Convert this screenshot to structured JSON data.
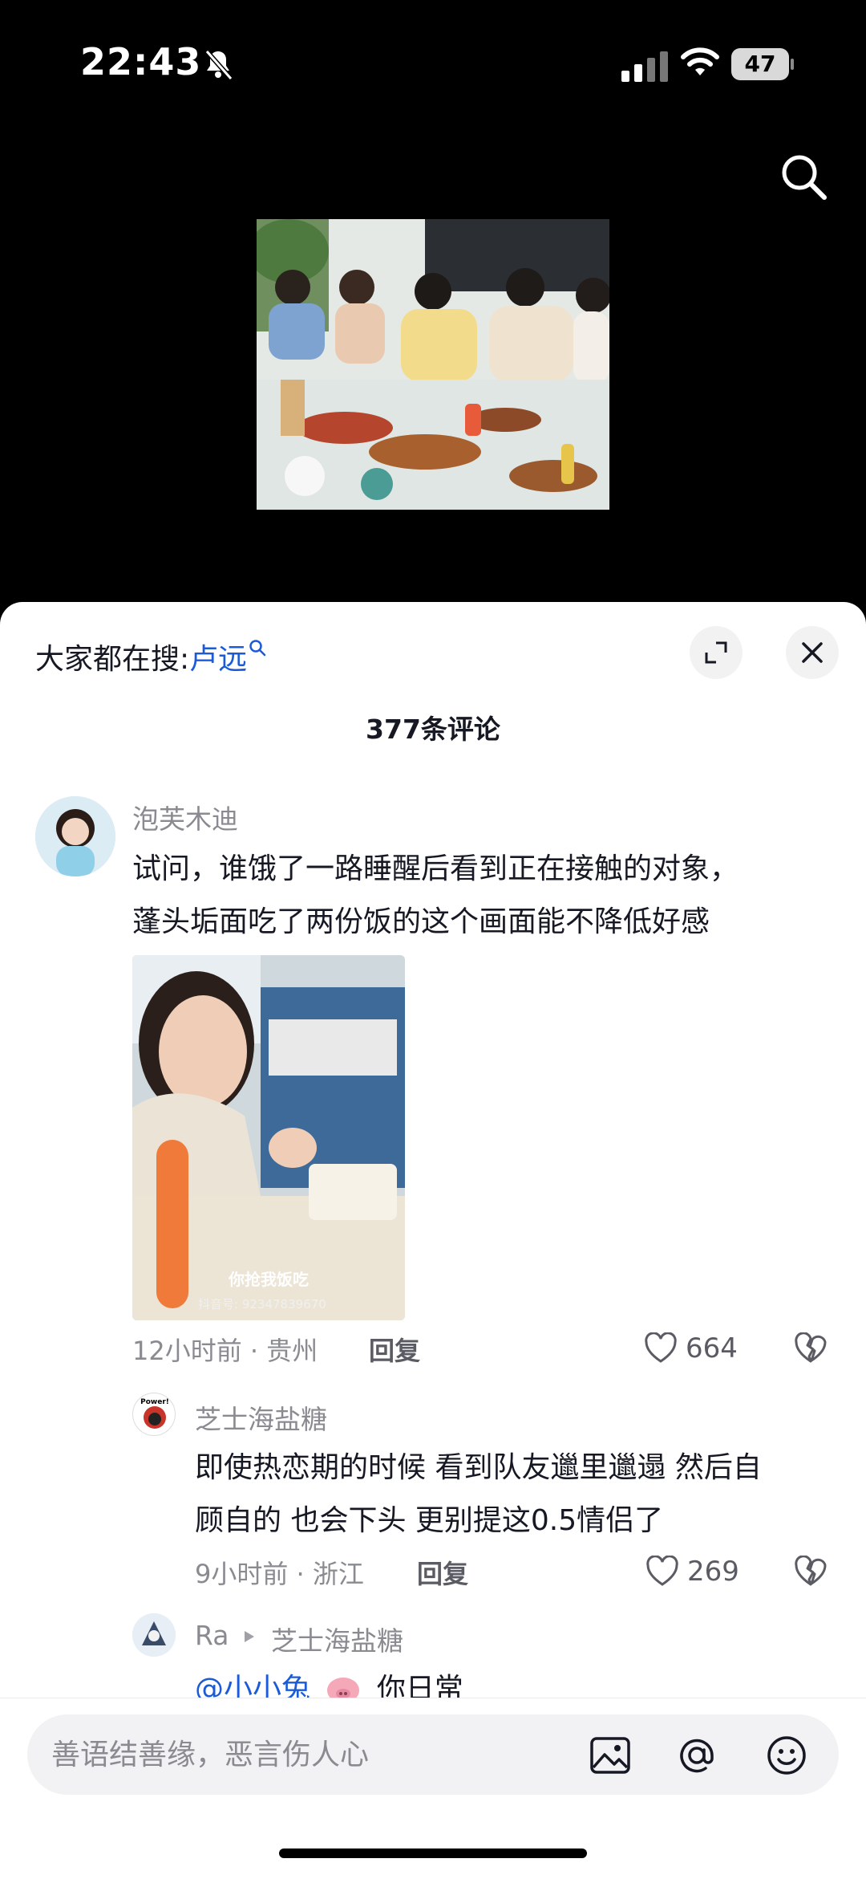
{
  "status_bar": {
    "time": "22:43",
    "battery": "47",
    "icons": [
      "bell-muted-icon",
      "signal-icon",
      "wifi-icon",
      "battery-icon"
    ]
  },
  "top": {
    "search_icon": "search-icon"
  },
  "sheet": {
    "trending_prefix": "大家都在搜:",
    "trending_keyword": "卢远",
    "comment_count": "377条评论"
  },
  "comments": [
    {
      "username": "泡芙木迪",
      "lines": [
        "试问，谁饿了一路睡醒后看到正在接触的对象，",
        "蓬头垢面吃了两份饭的这个画面能不降低好感"
      ],
      "image_caption": "你抢我饭吃",
      "image_watermark": "抖音号: 92347839670",
      "time_location": "12小时前 · 贵州",
      "reply_label": "回复",
      "likes": "664"
    },
    {
      "username": "芝士海盐糖",
      "avatar_text": "Power!",
      "lines": [
        "即使热恋期的时候 看到队友邋里邋遢 然后自",
        "顾自的 也会下头 更别提这0.5情侣了"
      ],
      "time_location": "9小时前 · 浙江",
      "reply_label": "回复",
      "likes": "269"
    },
    {
      "username": "Ra",
      "reply_to": "芝士海盐糖",
      "mention": "@小小兔",
      "text": "你日常"
    }
  ],
  "input": {
    "placeholder": "善语结善缘，恶言伤人心",
    "icons": [
      "image-icon",
      "at-icon",
      "emoji-icon"
    ]
  },
  "colors": {
    "keyword": "#1b5bd8",
    "meta": "#8a8b91",
    "text": "#161823"
  }
}
